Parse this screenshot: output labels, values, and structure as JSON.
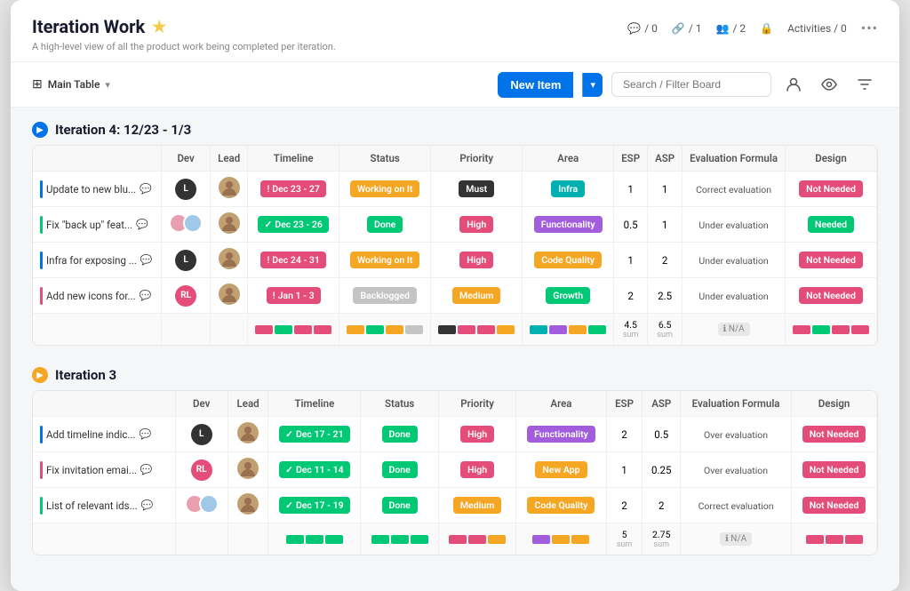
{
  "header": {
    "title": "Iteration Work",
    "star": "★",
    "subtitle": "A high-level view of all the product work being completed per iteration.",
    "stats": [
      {
        "icon": "💬",
        "value": "/ 0"
      },
      {
        "icon": "🔗",
        "value": "/ 1"
      },
      {
        "icon": "👥",
        "value": "/ 2"
      },
      {
        "icon": "🔒",
        "value": ""
      },
      {
        "label": "Activities / 0"
      }
    ]
  },
  "toolbar": {
    "table_label": "Main Table",
    "new_item_label": "New Item",
    "search_placeholder": "Search / Filter Board"
  },
  "iterations": [
    {
      "id": "iter4",
      "title": "Iteration 4: 12/23 - 1/3",
      "circle_color": "#0073ea",
      "columns": [
        "Dev",
        "Lead",
        "Timeline",
        "Status",
        "Priority",
        "Area",
        "ESP",
        "ASP",
        "Evaluation Formula",
        "Design"
      ],
      "rows": [
        {
          "name": "Update to new blu...",
          "bar_color": "#0073ea",
          "dev_initials": "L",
          "dev_color": "#333",
          "lead_avatar": true,
          "timeline": "Dec 23 - 27",
          "timeline_color": "#e44c7a",
          "timeline_icon": "!",
          "status": "Working on It",
          "status_color": "#f5a623",
          "priority": "Must",
          "priority_color": "#333",
          "area": "Infra",
          "area_color": "#00b0b0",
          "esp": 1,
          "asp": 1,
          "eval": "Correct evaluation",
          "design": "Not Needed",
          "design_color": "#e44c7a"
        },
        {
          "name": "Fix \"back up\" feat...",
          "bar_color": "#00c875",
          "dev_initials": "",
          "dev_avatar_multi": true,
          "lead_avatar": true,
          "timeline": "Dec 23 - 26",
          "timeline_color": "#00c875",
          "timeline_icon": "✓",
          "status": "Done",
          "status_color": "#00c875",
          "priority": "High",
          "priority_color": "#e44c7a",
          "area": "Functionality",
          "area_color": "#a25ddc",
          "esp": 0.5,
          "asp": 1,
          "eval": "Under evaluation",
          "design": "Needed",
          "design_color": "#00c875"
        },
        {
          "name": "Infra for exposing ...",
          "bar_color": "#0073ea",
          "dev_initials": "L",
          "dev_color": "#333",
          "lead_avatar": true,
          "timeline": "Dec 24 - 31",
          "timeline_color": "#e44c7a",
          "timeline_icon": "!",
          "status": "Working on It",
          "status_color": "#f5a623",
          "priority": "High",
          "priority_color": "#e44c7a",
          "area": "Code Quality",
          "area_color": "#f5a623",
          "esp": 1,
          "asp": 2,
          "eval": "Under evaluation",
          "design": "Not Needed",
          "design_color": "#e44c7a"
        },
        {
          "name": "Add new icons for...",
          "bar_color": "#e44c7a",
          "dev_initials": "RL",
          "dev_color": "#e44c7a",
          "lead_avatar": true,
          "timeline": "Jan 1 - 3",
          "timeline_color": "#e44c7a",
          "timeline_icon": "!",
          "status": "Backlogged",
          "status_color": "#c4c4c4",
          "priority": "Medium",
          "priority_color": "#f5a623",
          "area": "Growth",
          "area_color": "#00c875",
          "esp": 2,
          "asp": 2.5,
          "eval": "Under evaluation",
          "design": "Not Needed",
          "design_color": "#e44c7a"
        }
      ],
      "summary": {
        "esp_sum": "4.5",
        "asp_sum": "6.5",
        "na_label": "N/A",
        "swatches_timeline": [
          "#e44c7a",
          "#00c875",
          "#e44c7a",
          "#e44c7a"
        ],
        "swatches_status": [
          "#f5a623",
          "#00c875",
          "#f5a623",
          "#c4c4c4"
        ],
        "swatches_priority": [
          "#333",
          "#e44c7a",
          "#e44c7a",
          "#f5a623"
        ],
        "swatches_area": [
          "#00b0b0",
          "#a25ddc",
          "#f5a623",
          "#00c875"
        ],
        "swatches_design": [
          "#e44c7a",
          "#00c875",
          "#e44c7a",
          "#e44c7a"
        ]
      }
    },
    {
      "id": "iter3",
      "title": "Iteration 3",
      "circle_color": "#f5a623",
      "columns": [
        "Dev",
        "Lead",
        "Timeline",
        "Status",
        "Priority",
        "Area",
        "ESP",
        "ASP",
        "Evaluation Formula",
        "Design"
      ],
      "rows": [
        {
          "name": "Add timeline indic...",
          "bar_color": "#0073ea",
          "dev_initials": "L",
          "dev_color": "#333",
          "lead_avatar": true,
          "timeline": "Dec 17 - 21",
          "timeline_color": "#00c875",
          "timeline_icon": "✓",
          "status": "Done",
          "status_color": "#00c875",
          "priority": "High",
          "priority_color": "#e44c7a",
          "area": "Functionality",
          "area_color": "#a25ddc",
          "esp": 2,
          "asp": 0.5,
          "eval": "Over evaluation",
          "design": "Not Needed",
          "design_color": "#e44c7a"
        },
        {
          "name": "Fix invitation emai...",
          "bar_color": "#e44c7a",
          "dev_initials": "RL",
          "dev_color": "#e44c7a",
          "lead_avatar": true,
          "timeline": "Dec 11 - 14",
          "timeline_color": "#00c875",
          "timeline_icon": "✓",
          "status": "Done",
          "status_color": "#00c875",
          "priority": "High",
          "priority_color": "#e44c7a",
          "area": "New App",
          "area_color": "#f5a623",
          "esp": 1,
          "asp": 0.25,
          "eval": "Over evaluation",
          "design": "Not Needed",
          "design_color": "#e44c7a"
        },
        {
          "name": "List of relevant ids...",
          "bar_color": "#00c875",
          "dev_initials": "",
          "dev_avatar_multi": true,
          "lead_avatar": true,
          "timeline": "Dec 17 - 19",
          "timeline_color": "#00c875",
          "timeline_icon": "✓",
          "status": "Done",
          "status_color": "#00c875",
          "priority": "Medium",
          "priority_color": "#f5a623",
          "area": "Code Quality",
          "area_color": "#f5a623",
          "esp": 2,
          "asp": 2,
          "eval": "Correct evaluation",
          "design": "Not Needed",
          "design_color": "#e44c7a"
        }
      ],
      "summary": {
        "esp_sum": "5",
        "asp_sum": "2.75",
        "na_label": "N/A",
        "swatches_timeline": [
          "#00c875",
          "#00c875",
          "#00c875"
        ],
        "swatches_status": [
          "#00c875",
          "#00c875",
          "#00c875"
        ],
        "swatches_priority": [
          "#e44c7a",
          "#e44c7a",
          "#f5a623"
        ],
        "swatches_area": [
          "#a25ddc",
          "#f5a623",
          "#f5a623"
        ],
        "swatches_design": [
          "#e44c7a",
          "#e44c7a",
          "#e44c7a"
        ]
      }
    }
  ]
}
